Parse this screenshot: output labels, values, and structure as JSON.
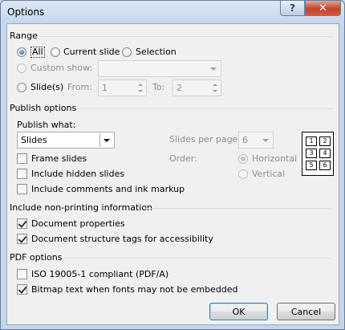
{
  "window": {
    "title": "Options",
    "help_glyph": "?",
    "close_glyph": "✕"
  },
  "range": {
    "heading": "Range",
    "all_label": "All",
    "current_slide_label": "Current slide",
    "selection_label": "Selection",
    "custom_show_label": "Custom show:",
    "custom_show_value": "",
    "slides_label": "Slide(s)",
    "from_label": "From:",
    "from_value": "1",
    "to_label": "To:",
    "to_value": "2"
  },
  "publish": {
    "heading": "Publish options",
    "what_label": "Publish what:",
    "what_value": "Slides",
    "frame_slides_label": "Frame slides",
    "include_hidden_label": "Include hidden slides",
    "include_comments_label": "Include comments and ink markup",
    "slides_per_page_label": "Slides per page:",
    "slides_per_page_value": "6",
    "order_label": "Order:",
    "horizontal_label": "Horizontal",
    "vertical_label": "Vertical",
    "preview_cells": [
      "1",
      "2",
      "3",
      "4",
      "5",
      "6"
    ]
  },
  "nonprinting": {
    "heading": "Include non-printing information",
    "doc_props_label": "Document properties",
    "doc_tags_label": "Document structure tags for accessibility"
  },
  "pdf": {
    "heading": "PDF options",
    "iso_label": "ISO 19005-1 compliant (PDF/A)",
    "bitmap_label": "Bitmap text when fonts may not be embedded"
  },
  "buttons": {
    "ok": "OK",
    "cancel": "Cancel"
  }
}
